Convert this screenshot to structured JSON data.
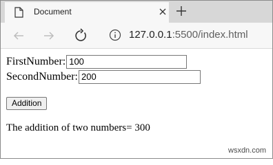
{
  "tab": {
    "title": "Document",
    "icon": "page-icon"
  },
  "toolbar": {
    "address_host": "127.0.0.1",
    "address_rest": ":5500/index.html"
  },
  "form": {
    "first_label": "FirstNumber:",
    "first_value": "100",
    "second_label": "SecondNumber:",
    "second_value": "200",
    "button_label": "Addition"
  },
  "result": {
    "text": "The addition of two numbers= 300"
  },
  "watermark": "wsxdn.com"
}
